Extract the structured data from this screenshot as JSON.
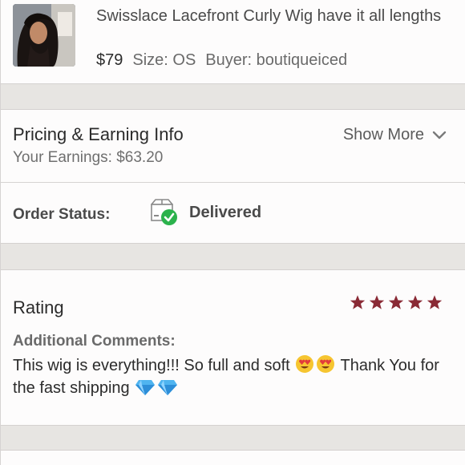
{
  "item": {
    "title": "Swisslace Lacefront Curly Wig have it all lengths",
    "price": "$79",
    "size": "Size: OS",
    "buyer": "Buyer: boutiqueiced"
  },
  "pricing": {
    "heading": "Pricing & Earning Info",
    "earnings": "Your Earnings: $63.20",
    "show_more": "Show More"
  },
  "order_status": {
    "label": "Order Status:",
    "value": "Delivered",
    "icon": "package-delivered-icon"
  },
  "rating": {
    "heading": "Rating",
    "stars": 5,
    "star_color": "#8a2a35",
    "comments_label": "Additional Comments:",
    "comment_part1": "This wig is everything!!! So full and soft",
    "comment_part2": "Thank You for the fast shipping"
  },
  "colors": {
    "band": "#e7e5e2",
    "success": "#2bb24c",
    "text": "#2b2b2b"
  }
}
